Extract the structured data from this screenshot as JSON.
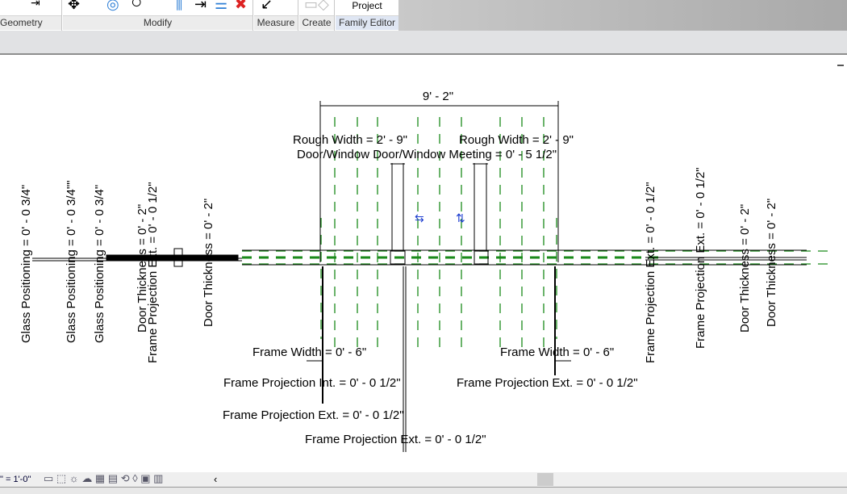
{
  "ribbon": {
    "panels": [
      {
        "label": "Geometry"
      },
      {
        "label": "Modify"
      },
      {
        "label": "Measure"
      },
      {
        "label": "Create"
      },
      {
        "label": "Family Editor"
      }
    ],
    "project_label": "Project"
  },
  "drawing": {
    "overall_dim": "9' - 2\"",
    "rough_width_left": "Rough Width = 2' - 9\"",
    "rough_width_right": "Rough Width = 2' - 9\"",
    "meeting_label": "Door/Window Door/Window Meeting = 0' - 5 1/2\"",
    "vertical_labels": [
      "Glass Positioning = 0' - 0 3/4\"",
      "Glass Positioning = 0' - 0 3/4\"\"",
      "Glass Positioning = 0' - 0 3/4\"",
      "Door Thickness = 0' - 2\"",
      "Frame Projection Ext. = 0' - 0 1/2\"",
      "Door Thickness = 0' - 2\"",
      "Frame Projection Ext. = 0' - 0 1/2\"",
      "Frame Projection Ext. = 0' - 0 1/2\"",
      "Door Thickness = 0' - 2\"",
      "Door Thickness = 0' - 2\""
    ],
    "frame_width_left": "Frame Width = 0' - 6\"",
    "frame_width_right": "Frame Width = 0' - 6\"",
    "frame_proj_int": "Frame Projection Int. = 0' - 0 1/2\"",
    "frame_proj_ext_right": "Frame Projection Ext. = 0' - 0 1/2\"",
    "frame_proj_ext_left": "Frame Projection Ext. = 0' - 0 1/2\"",
    "frame_proj_ext_bottom": "Frame Projection Ext. = 0' - 0 1/2\""
  },
  "status": {
    "scale": "\" = 1'-0\"",
    "collapse": "‹"
  },
  "colors": {
    "ref_plane": "#1a8a1a",
    "flip": "#1f3fd0"
  }
}
